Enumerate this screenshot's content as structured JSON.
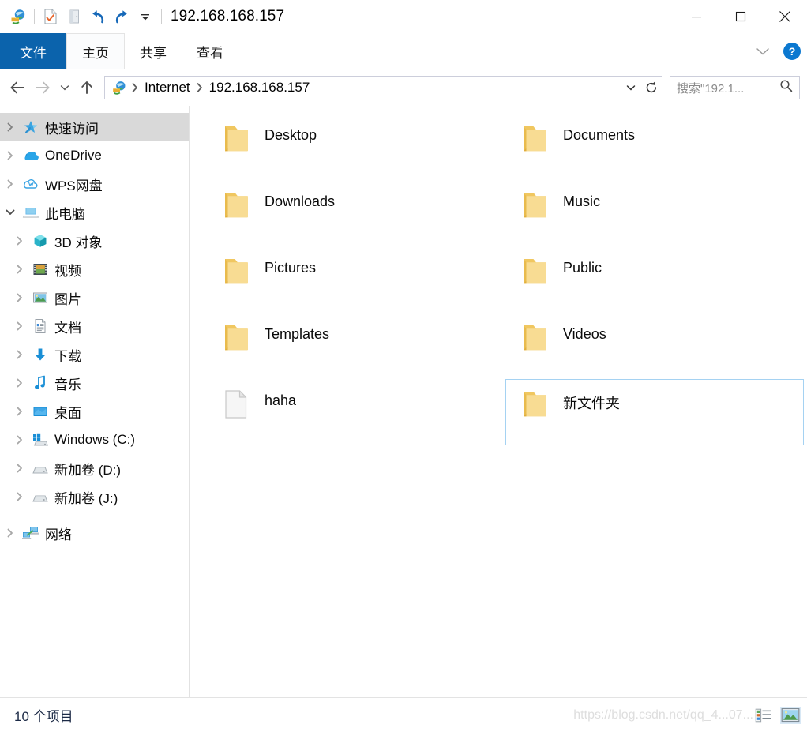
{
  "window": {
    "title": "192.168.168.157",
    "quick_access_toolbar": [
      {
        "name": "ftp-site-icon",
        "label": "FTP 站点"
      },
      {
        "name": "properties-icon",
        "label": "属性"
      },
      {
        "name": "open-folder-icon",
        "label": "打开"
      },
      {
        "name": "undo-icon",
        "label": "撤消"
      },
      {
        "name": "redo-icon",
        "label": "恢复"
      },
      {
        "name": "customize-dropdown-icon",
        "label": "自定义快速访问工具栏"
      }
    ],
    "controls": {
      "minimize": "—",
      "maximize": "□",
      "close": "✕"
    }
  },
  "ribbon": {
    "tabs": [
      {
        "label": "文件",
        "state": "file"
      },
      {
        "label": "主页",
        "state": "active"
      },
      {
        "label": "共享",
        "state": "normal"
      },
      {
        "label": "查看",
        "state": "normal"
      }
    ],
    "collapse_label": "折叠功能区",
    "help_label": "?"
  },
  "address": {
    "back_label": "后退",
    "forward_label": "前进",
    "recent_label": "最近浏览的位置",
    "up_label": "上移到",
    "site_icon": "ftp-site-icon",
    "breadcrumbs": [
      "Internet",
      "192.168.168.157"
    ],
    "dropdown_label": "之前的位置",
    "refresh_label": "刷新",
    "search_placeholder": "搜索\"192.1..."
  },
  "sidebar": {
    "items": [
      {
        "label": "快速访问",
        "icon": "star-pin-icon",
        "level": 1,
        "expander": "collapsed",
        "selected": true
      },
      {
        "label": "OneDrive",
        "icon": "onedrive-cloud-icon",
        "level": 1,
        "expander": "collapsed",
        "selected": false
      },
      {
        "label": "WPS网盘",
        "icon": "wps-cloud-icon",
        "level": 1,
        "expander": "collapsed",
        "selected": false
      },
      {
        "label": "此电脑",
        "icon": "this-pc-icon",
        "level": 1,
        "expander": "expanded",
        "selected": false
      },
      {
        "label": "3D 对象",
        "icon": "3d-objects-icon",
        "level": 2,
        "expander": "collapsed",
        "selected": false
      },
      {
        "label": "视频",
        "icon": "videos-icon",
        "level": 2,
        "expander": "collapsed",
        "selected": false
      },
      {
        "label": "图片",
        "icon": "pictures-icon",
        "level": 2,
        "expander": "collapsed",
        "selected": false
      },
      {
        "label": "文档",
        "icon": "documents-icon",
        "level": 2,
        "expander": "collapsed",
        "selected": false
      },
      {
        "label": "下载",
        "icon": "downloads-icon",
        "level": 2,
        "expander": "collapsed",
        "selected": false
      },
      {
        "label": "音乐",
        "icon": "music-icon",
        "level": 2,
        "expander": "collapsed",
        "selected": false
      },
      {
        "label": "桌面",
        "icon": "desktop-icon",
        "level": 2,
        "expander": "collapsed",
        "selected": false
      },
      {
        "label": "Windows (C:)",
        "icon": "windows-drive-icon",
        "level": 2,
        "expander": "collapsed",
        "selected": false
      },
      {
        "label": "新加卷 (D:)",
        "icon": "drive-icon",
        "level": 2,
        "expander": "collapsed",
        "selected": false
      },
      {
        "label": "新加卷 (J:)",
        "icon": "drive-icon",
        "level": 2,
        "expander": "collapsed",
        "selected": false
      },
      {
        "label": "网络",
        "icon": "network-icon",
        "level": 1,
        "expander": "collapsed",
        "selected": false
      }
    ]
  },
  "files": {
    "items": [
      {
        "name": "Desktop",
        "type": "folder",
        "selected": false
      },
      {
        "name": "Documents",
        "type": "folder",
        "selected": false
      },
      {
        "name": "Downloads",
        "type": "folder",
        "selected": false
      },
      {
        "name": "Music",
        "type": "folder",
        "selected": false
      },
      {
        "name": "Pictures",
        "type": "folder",
        "selected": false
      },
      {
        "name": "Public",
        "type": "folder",
        "selected": false
      },
      {
        "name": "Templates",
        "type": "folder",
        "selected": false
      },
      {
        "name": "Videos",
        "type": "folder",
        "selected": false
      },
      {
        "name": "haha",
        "type": "file",
        "selected": false
      },
      {
        "name": "新文件夹",
        "type": "folder",
        "selected": true
      }
    ]
  },
  "statusbar": {
    "item_count": "10 个项目",
    "watermark": "https://blog.csdn.net/qq_4...07...",
    "views": [
      {
        "name": "details-view-button",
        "label": "详细信息",
        "active": false
      },
      {
        "name": "large-icons-view-button",
        "label": "大图标",
        "active": true
      }
    ]
  },
  "colors": {
    "accent_blue": "#0b63ac",
    "help_blue": "#0b78d0",
    "selection_border": "#a5d2f2",
    "tree_selection": "#d9d9d9",
    "folder_yellow": "#f7d684",
    "folder_yellow_dark": "#f0c762"
  }
}
